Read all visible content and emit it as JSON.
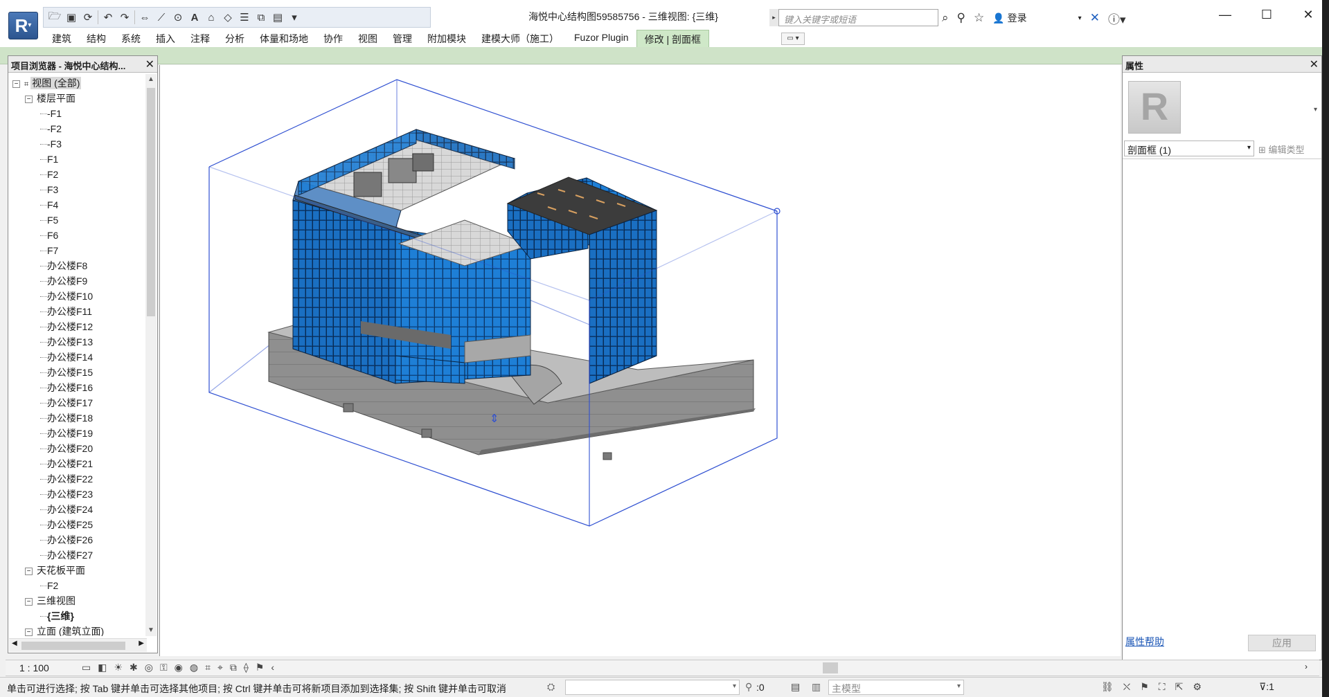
{
  "app": {
    "logo": "R",
    "doc_title": "海悦中心结构图59585756 - 三维视图: {三维}",
    "search_placeholder": "键入关键字或短语",
    "login_label": "登录"
  },
  "qat_icons": [
    "open-icon",
    "save-icon",
    "sync-icon",
    "undo-icon",
    "redo-icon",
    "measure-icon",
    "dimension-icon",
    "tag-icon",
    "text-icon",
    "3d-view-icon",
    "section-icon",
    "thin-lines-icon",
    "close-windows-icon",
    "switch-windows-icon",
    "customize-icon"
  ],
  "ribbon": {
    "tabs": [
      "建筑",
      "结构",
      "系统",
      "插入",
      "注释",
      "分析",
      "体量和场地",
      "协作",
      "视图",
      "管理",
      "附加模块",
      "建模大师（施工）",
      "Fuzor Plugin",
      "修改 | 剖面框"
    ],
    "active_index": 13
  },
  "browser": {
    "title": "项目浏览器 - 海悦中心结构...",
    "root": "视图 (全部)",
    "floor_plans": "楼层平面",
    "floor_items": [
      "-F1",
      "-F2",
      "-F3",
      "F1",
      "F2",
      "F3",
      "F4",
      "F5",
      "F6",
      "F7",
      "办公楼F8",
      "办公楼F9",
      "办公楼F10",
      "办公楼F11",
      "办公楼F12",
      "办公楼F13",
      "办公楼F14",
      "办公楼F15",
      "办公楼F16",
      "办公楼F17",
      "办公楼F18",
      "办公楼F19",
      "办公楼F20",
      "办公楼F21",
      "办公楼F22",
      "办公楼F23",
      "办公楼F24",
      "办公楼F25",
      "办公楼F26",
      "办公楼F27"
    ],
    "ceiling_plans": "天花板平面",
    "ceiling_items": [
      "F2"
    ],
    "views_3d": "三维视图",
    "views_3d_items": [
      "{三维}"
    ],
    "elevations": "立面 (建筑立面)"
  },
  "properties": {
    "title": "属性",
    "type_selector": "剖面框 (1)",
    "edit_type": "编辑类型",
    "help": "属性帮助",
    "apply": "应用"
  },
  "viewbar": {
    "scale": "1 : 100"
  },
  "status": {
    "message": "单击可进行选择; 按 Tab 键并单击可选择其他项目; 按 Ctrl 键并单击可将新项目添加到选择集; 按 Shift 键并单击可取消",
    "zero": ":0",
    "model": "主模型",
    "filter_count": ":1"
  },
  "colors": {
    "accent_tab": "#cfe8c8",
    "glass": "#1a6fc2",
    "concrete": "#9a9a9a",
    "section_box": "#2e4fd1"
  }
}
